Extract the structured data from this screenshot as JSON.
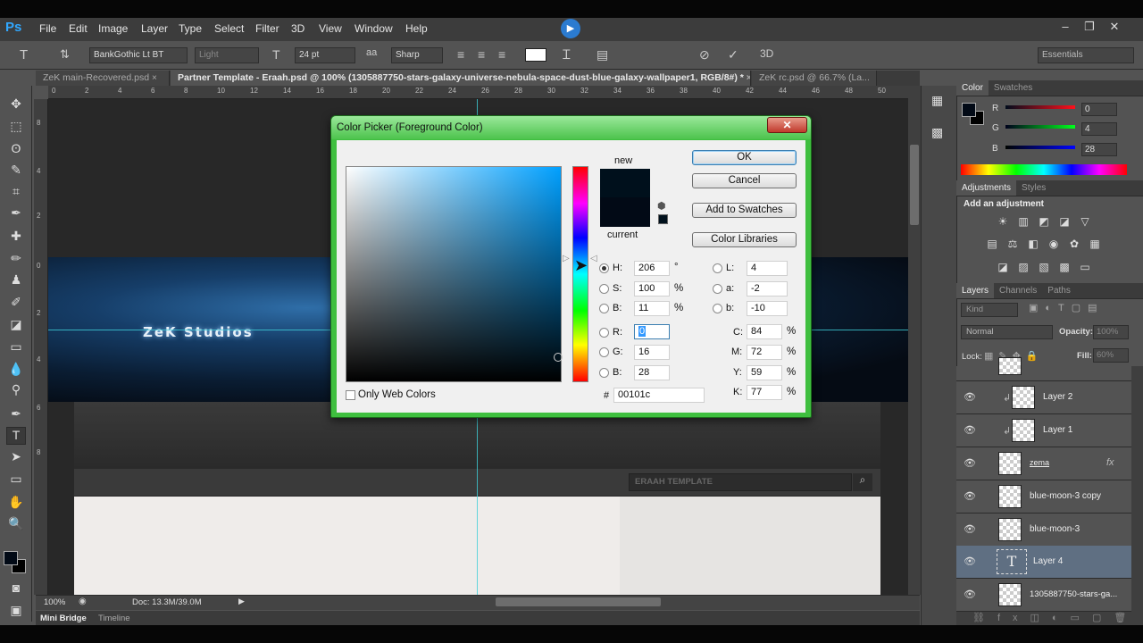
{
  "app": {
    "logo": "Ps",
    "menu": [
      "File",
      "Edit",
      "Image",
      "Layer",
      "Type",
      "Select",
      "Filter",
      "3D",
      "View",
      "Window",
      "Help"
    ]
  },
  "options": {
    "font_family": "BankGothic Lt BT",
    "font_style": "Light",
    "font_size": "24 pt",
    "antialias_label": "aa",
    "antialias": "Sharp",
    "three_d": "3D",
    "workspace": "Essentials"
  },
  "tabs": [
    {
      "label": "ZeK main-Recovered.psd"
    },
    {
      "label": "Partner Template - Eraah.psd @ 100% (1305887750-stars-galaxy-universe-nebula-space-dust-blue-galaxy-wallpaper1, RGB/8#) *"
    },
    {
      "label": "ZeK rc.psd @ 66.7% (La..."
    }
  ],
  "ruler": {
    "top": [
      "0",
      "2",
      "4",
      "6",
      "8",
      "10",
      "12",
      "14",
      "16",
      "18",
      "20",
      "22",
      "24",
      "26",
      "28",
      "30",
      "32",
      "34",
      "36",
      "38",
      "40",
      "42",
      "44",
      "46",
      "48",
      "50",
      "52"
    ],
    "left": [
      "8",
      "4",
      "2",
      "0",
      "2",
      "4",
      "6",
      "8"
    ]
  },
  "canvas": {
    "brand": "ZeK Studios",
    "template_search": "ERAAH TEMPLATE"
  },
  "status": {
    "zoom": "100%",
    "doc": "Doc: 13.3M/39.0M",
    "tabs": [
      "Mini Bridge",
      "Timeline"
    ]
  },
  "dialog": {
    "title": "Color Picker (Foreground Color)",
    "new_label": "new",
    "current_label": "current",
    "buttons": {
      "ok": "OK",
      "cancel": "Cancel",
      "add_swatches": "Add to Swatches",
      "libraries": "Color Libraries"
    },
    "hsb": [
      {
        "label": "H:",
        "value": "206",
        "unit": "°"
      },
      {
        "label": "S:",
        "value": "100",
        "unit": "%"
      },
      {
        "label": "B:",
        "value": "11",
        "unit": "%"
      }
    ],
    "rgb": [
      {
        "label": "R:",
        "value": "0"
      },
      {
        "label": "G:",
        "value": "16"
      },
      {
        "label": "B:",
        "value": "28"
      }
    ],
    "lab": [
      {
        "label": "L:",
        "value": "4"
      },
      {
        "label": "a:",
        "value": "-2"
      },
      {
        "label": "b:",
        "value": "-10"
      }
    ],
    "cmyk": [
      {
        "label": "C:",
        "value": "84",
        "unit": "%"
      },
      {
        "label": "M:",
        "value": "72",
        "unit": "%"
      },
      {
        "label": "Y:",
        "value": "59",
        "unit": "%"
      },
      {
        "label": "K:",
        "value": "77",
        "unit": "%"
      }
    ],
    "hex_label": "#",
    "hex": "00101c",
    "web_only": "Only Web Colors",
    "new_color": "#00101c",
    "current_color": "#020a16"
  },
  "color_panel": {
    "tabs": [
      "Color",
      "Swatches"
    ],
    "r_label": "R",
    "g_label": "G",
    "b_label": "B",
    "r": "0",
    "g": "4",
    "b": "28"
  },
  "adjustments": {
    "tabs": [
      "Adjustments",
      "Styles"
    ],
    "heading": "Add an adjustment"
  },
  "layers": {
    "tabs": [
      "Layers",
      "Channels",
      "Paths"
    ],
    "kind": "Kind",
    "blend": "Normal",
    "opacity_label": "Opacity:",
    "opacity": "100%",
    "lock_label": "Lock:",
    "fill_label": "Fill:",
    "fill": "60%",
    "items": [
      "Layer 2",
      "Layer 1",
      "zema",
      "blue-moon-3 copy",
      "blue-moon-3",
      "Layer 4",
      "1305887750-stars-ga..."
    ]
  }
}
